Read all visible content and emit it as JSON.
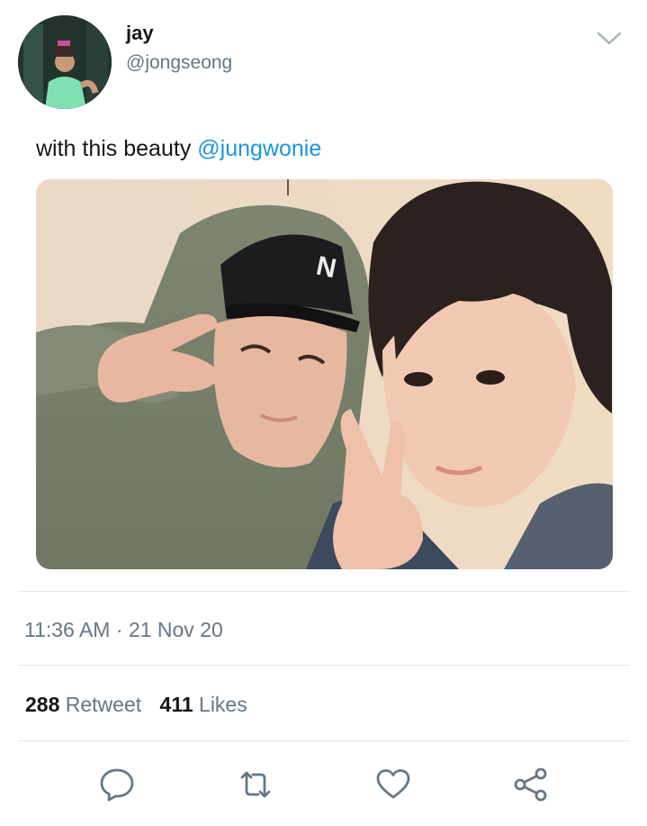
{
  "user": {
    "display_name": "jay",
    "handle": "@jongseong"
  },
  "tweet": {
    "text": "with this beauty ",
    "mention": "@jungwonie"
  },
  "meta": {
    "time": "11:36 AM",
    "separator": " · ",
    "date": "21 Nov 20"
  },
  "stats": {
    "retweet_count": "288",
    "retweet_label": "Retweet",
    "like_count": "411",
    "like_label": "Likes"
  },
  "colors": {
    "accent": "#1b95e0",
    "secondary_text": "#657786",
    "icon": "#657786",
    "divider": "#e1e8ed"
  },
  "icons": {
    "menu": "chevron-down-icon",
    "reply": "reply-bubble-icon",
    "retweet": "retweet-icon",
    "like": "heart-icon",
    "share": "share-icon"
  }
}
